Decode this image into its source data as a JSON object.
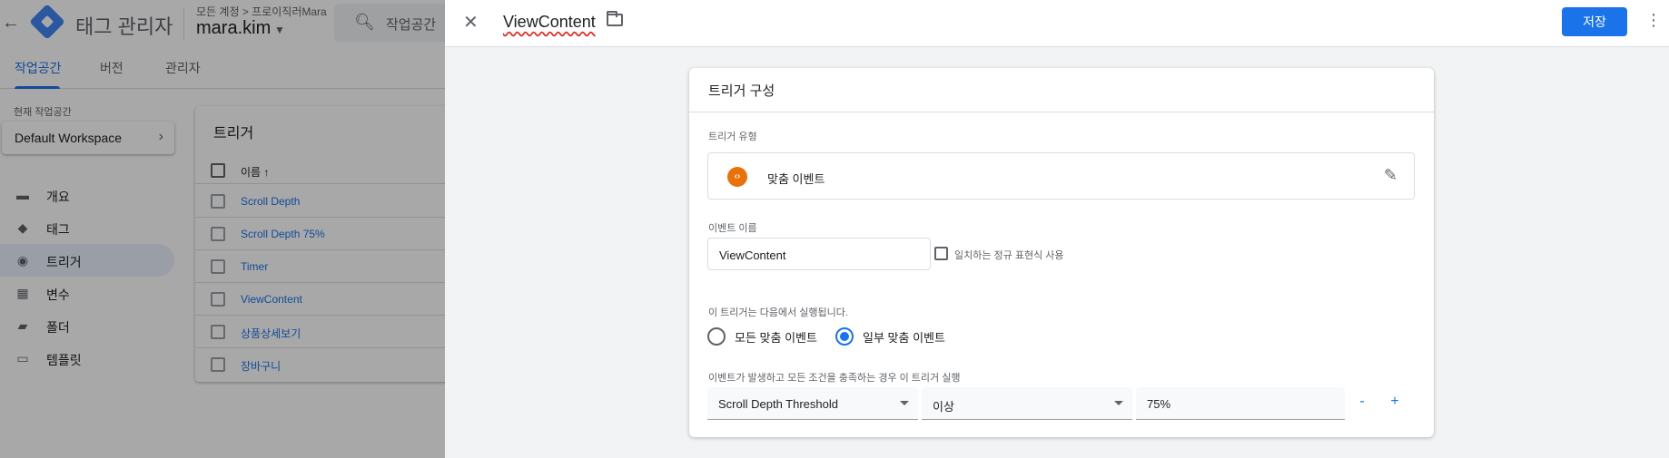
{
  "app": {
    "title": "태그 관리자",
    "account_breadcrumb": "모든 계정 > 프로이직러Mara",
    "account_name": "mara.kim",
    "search_placeholder": "작업공간"
  },
  "nav_tabs": [
    {
      "label": "작업공간",
      "active": true
    },
    {
      "label": "버전",
      "active": false
    },
    {
      "label": "관리자",
      "active": false
    }
  ],
  "workspace": {
    "label": "현재 작업공간",
    "name": "Default Workspace"
  },
  "sidebar": {
    "items": [
      {
        "label": "개요",
        "icon": "briefcase-icon"
      },
      {
        "label": "태그",
        "icon": "tag-icon"
      },
      {
        "label": "트리거",
        "icon": "trigger-icon",
        "active": true
      },
      {
        "label": "변수",
        "icon": "variables-icon"
      },
      {
        "label": "폴더",
        "icon": "folder-icon"
      },
      {
        "label": "템플릿",
        "icon": "template-icon"
      }
    ]
  },
  "triggers_list": {
    "title": "트리거",
    "column_name": "이름 ↑",
    "rows": [
      "Scroll Depth",
      "Scroll Depth 75%",
      "Timer",
      "ViewContent",
      "상품상세보기",
      "장바구니"
    ]
  },
  "panel": {
    "title": "ViewContent",
    "save_label": "저장"
  },
  "config": {
    "title": "트리거 구성",
    "type_label": "트리거 유형",
    "type_name": "맞춤 이벤트",
    "type_icon_glyph": "‹›",
    "event_name_label": "이벤트 이름",
    "event_name_value": "ViewContent",
    "regex_label": "일치하는 정규 표현식 사용",
    "fires_on_label": "이 트리거는 다음에서 실행됩니다.",
    "radio_all": "모든 맞춤 이벤트",
    "radio_some": "일부 맞춤 이벤트",
    "radio_selected": "some",
    "condition_label": "이벤트가 발생하고 모든 조건을 충족하는 경우 이 트리거 실행",
    "condition": {
      "variable": "Scroll Depth Threshold",
      "operator": "이상",
      "value": "75%"
    },
    "remove_label": "-",
    "add_label": "+"
  },
  "colors": {
    "accent": "#1a73e8",
    "trigger_type_icon": "#e8710a",
    "active_nav_bg": "#e8f0fe"
  }
}
